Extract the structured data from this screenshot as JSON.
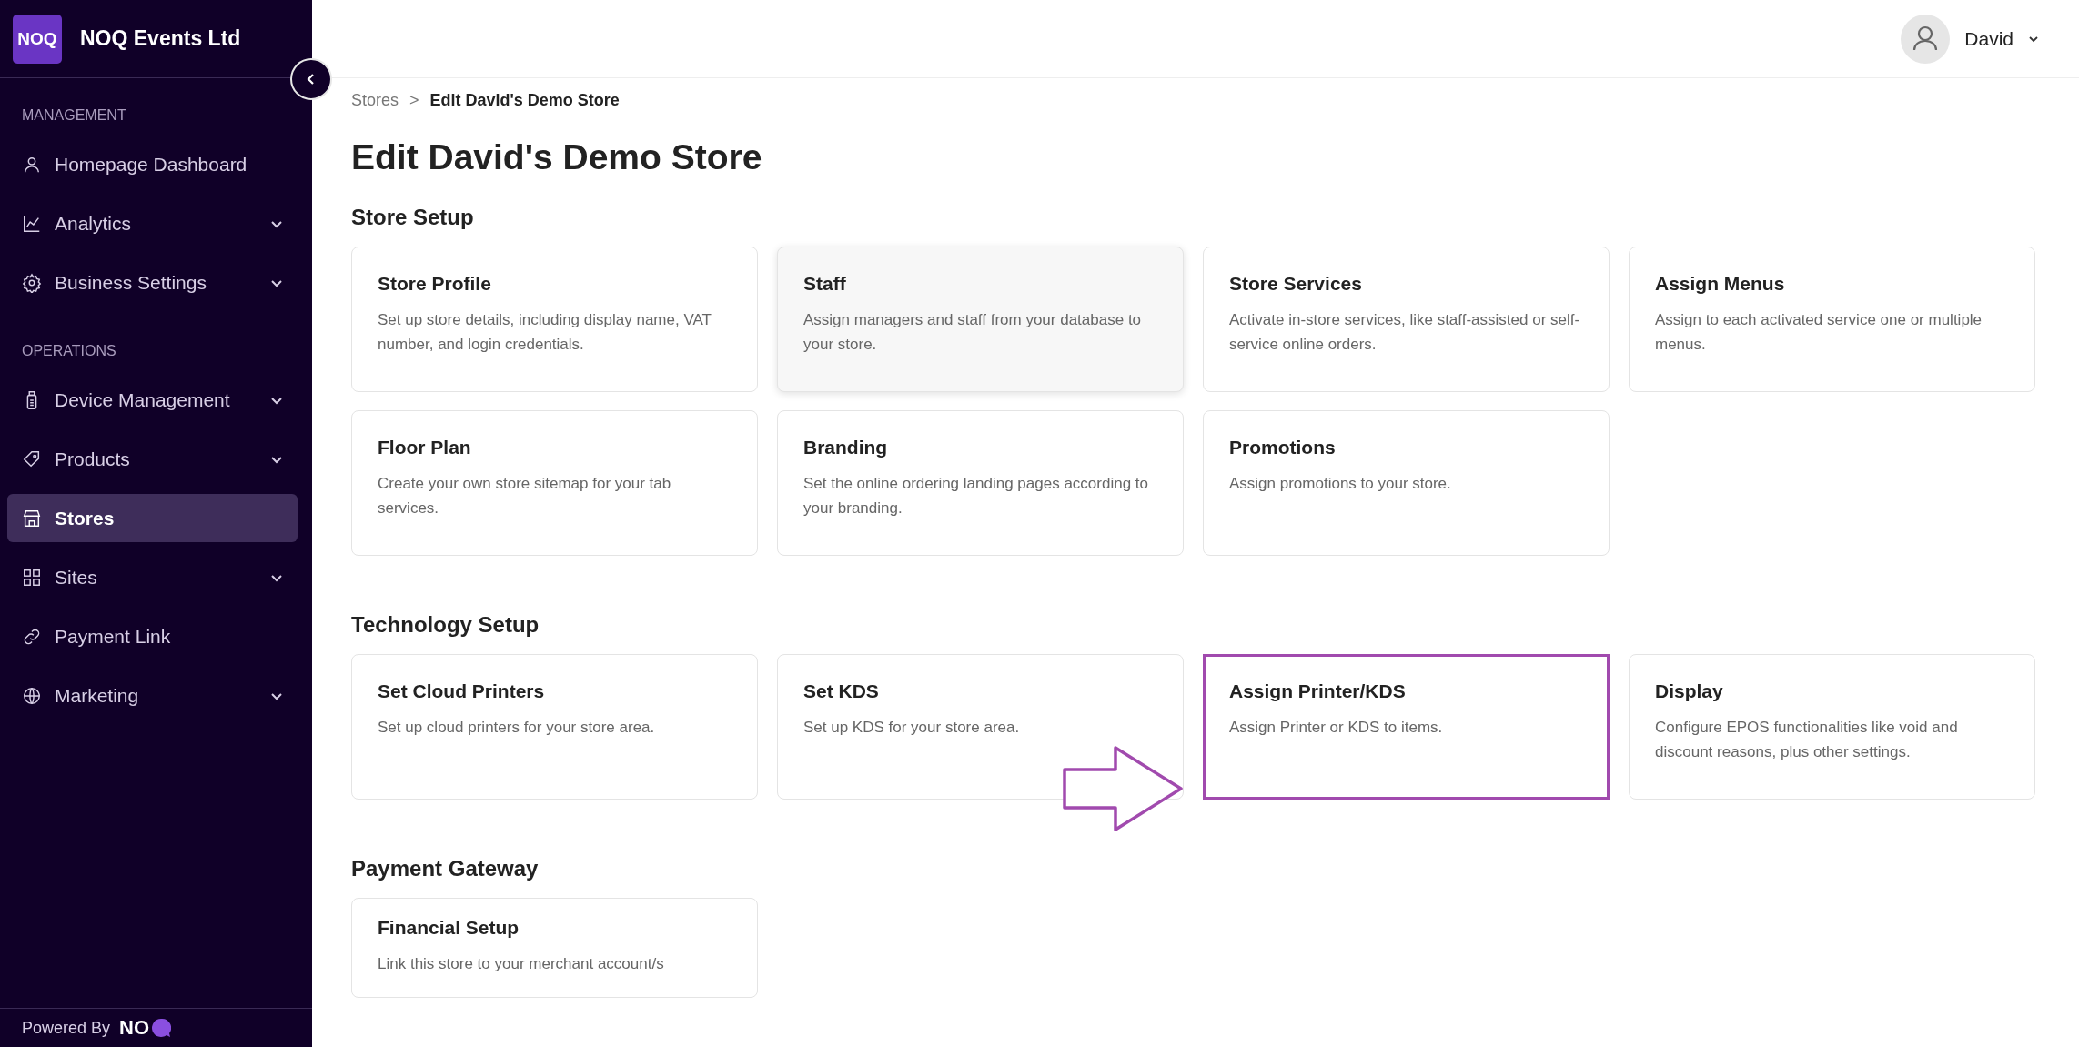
{
  "sidebar": {
    "logo": "NOQ",
    "org": "NOQ Events Ltd",
    "sections": [
      {
        "label": "MANAGEMENT",
        "items": [
          {
            "label": "Homepage Dashboard",
            "expandable": false,
            "selected": false
          },
          {
            "label": "Analytics",
            "expandable": true,
            "selected": false
          },
          {
            "label": "Business Settings",
            "expandable": true,
            "selected": false
          }
        ]
      },
      {
        "label": "OPERATIONS",
        "items": [
          {
            "label": "Device Management",
            "expandable": true,
            "selected": false
          },
          {
            "label": "Products",
            "expandable": true,
            "selected": false
          },
          {
            "label": "Stores",
            "expandable": false,
            "selected": true
          },
          {
            "label": "Sites",
            "expandable": true,
            "selected": false
          },
          {
            "label": "Payment Link",
            "expandable": false,
            "selected": false
          },
          {
            "label": "Marketing",
            "expandable": true,
            "selected": false
          }
        ]
      }
    ],
    "footer": {
      "label": "Powered By",
      "logo": "NO"
    }
  },
  "header": {
    "user": "David"
  },
  "breadcrumb": {
    "items": [
      "Stores",
      "Edit David's Demo Store"
    ],
    "separator": ">"
  },
  "title": "Edit David's Demo Store",
  "sections": [
    {
      "heading": "Store Setup",
      "cards": [
        {
          "title": "Store Profile",
          "description": "Set up store details, including display name, VAT number, and login credentials.",
          "hovered": false,
          "highlighted": false
        },
        {
          "title": "Staff",
          "description": "Assign managers and staff from your database to your store.",
          "hovered": true,
          "highlighted": false
        },
        {
          "title": "Store Services",
          "description": "Activate in-store services, like staff-assisted or self-service online orders.",
          "hovered": false,
          "highlighted": false
        },
        {
          "title": "Assign Menus",
          "description": "Assign to each activated service one or multiple menus.",
          "hovered": false,
          "highlighted": false
        },
        {
          "title": "Floor Plan",
          "description": "Create your own store sitemap for your tab services.",
          "hovered": false,
          "highlighted": false
        },
        {
          "title": "Branding",
          "description": "Set the online ordering landing pages according to your branding.",
          "hovered": false,
          "highlighted": false
        },
        {
          "title": "Promotions",
          "description": "Assign promotions to your store.",
          "hovered": false,
          "highlighted": false
        }
      ]
    },
    {
      "heading": "Technology Setup",
      "cards": [
        {
          "title": "Set Cloud Printers",
          "description": "Set up cloud printers for your store area.",
          "hovered": false,
          "highlighted": false
        },
        {
          "title": "Set KDS",
          "description": "Set up KDS for your store area.",
          "hovered": false,
          "highlighted": false
        },
        {
          "title": "Assign Printer/KDS",
          "description": "Assign Printer or KDS to items.",
          "hovered": false,
          "highlighted": true
        },
        {
          "title": "Display",
          "description": "Configure EPOS functionalities like void and discount reasons, plus other settings.",
          "hovered": false,
          "highlighted": false
        }
      ]
    },
    {
      "heading": "Payment Gateway",
      "cards": [
        {
          "title": "Financial Setup",
          "description": "Link this store to your merchant account/s",
          "hovered": false,
          "highlighted": false
        }
      ]
    }
  ]
}
